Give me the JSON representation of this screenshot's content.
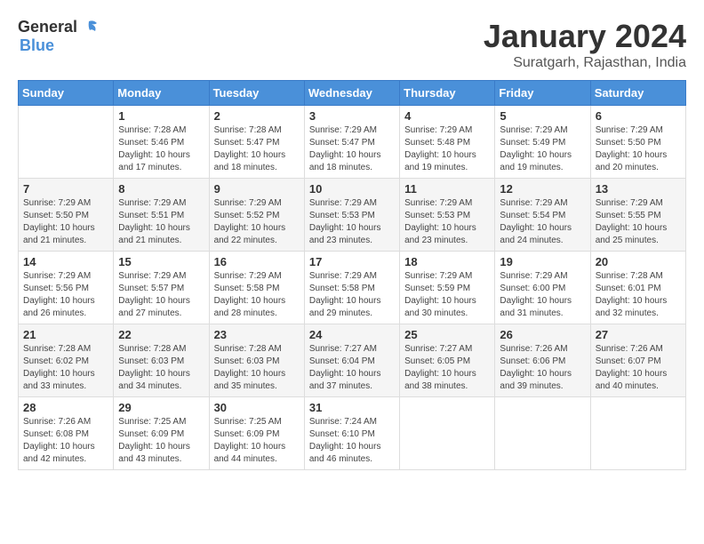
{
  "header": {
    "logo_general": "General",
    "logo_blue": "Blue",
    "month_title": "January 2024",
    "location": "Suratgarh, Rajasthan, India"
  },
  "weekdays": [
    "Sunday",
    "Monday",
    "Tuesday",
    "Wednesday",
    "Thursday",
    "Friday",
    "Saturday"
  ],
  "weeks": [
    [
      {
        "day": "",
        "sunrise": "",
        "sunset": "",
        "daylight": ""
      },
      {
        "day": "1",
        "sunrise": "Sunrise: 7:28 AM",
        "sunset": "Sunset: 5:46 PM",
        "daylight": "Daylight: 10 hours and 17 minutes."
      },
      {
        "day": "2",
        "sunrise": "Sunrise: 7:28 AM",
        "sunset": "Sunset: 5:47 PM",
        "daylight": "Daylight: 10 hours and 18 minutes."
      },
      {
        "day": "3",
        "sunrise": "Sunrise: 7:29 AM",
        "sunset": "Sunset: 5:47 PM",
        "daylight": "Daylight: 10 hours and 18 minutes."
      },
      {
        "day": "4",
        "sunrise": "Sunrise: 7:29 AM",
        "sunset": "Sunset: 5:48 PM",
        "daylight": "Daylight: 10 hours and 19 minutes."
      },
      {
        "day": "5",
        "sunrise": "Sunrise: 7:29 AM",
        "sunset": "Sunset: 5:49 PM",
        "daylight": "Daylight: 10 hours and 19 minutes."
      },
      {
        "day": "6",
        "sunrise": "Sunrise: 7:29 AM",
        "sunset": "Sunset: 5:50 PM",
        "daylight": "Daylight: 10 hours and 20 minutes."
      }
    ],
    [
      {
        "day": "7",
        "sunrise": "Sunrise: 7:29 AM",
        "sunset": "Sunset: 5:50 PM",
        "daylight": "Daylight: 10 hours and 21 minutes."
      },
      {
        "day": "8",
        "sunrise": "Sunrise: 7:29 AM",
        "sunset": "Sunset: 5:51 PM",
        "daylight": "Daylight: 10 hours and 21 minutes."
      },
      {
        "day": "9",
        "sunrise": "Sunrise: 7:29 AM",
        "sunset": "Sunset: 5:52 PM",
        "daylight": "Daylight: 10 hours and 22 minutes."
      },
      {
        "day": "10",
        "sunrise": "Sunrise: 7:29 AM",
        "sunset": "Sunset: 5:53 PM",
        "daylight": "Daylight: 10 hours and 23 minutes."
      },
      {
        "day": "11",
        "sunrise": "Sunrise: 7:29 AM",
        "sunset": "Sunset: 5:53 PM",
        "daylight": "Daylight: 10 hours and 23 minutes."
      },
      {
        "day": "12",
        "sunrise": "Sunrise: 7:29 AM",
        "sunset": "Sunset: 5:54 PM",
        "daylight": "Daylight: 10 hours and 24 minutes."
      },
      {
        "day": "13",
        "sunrise": "Sunrise: 7:29 AM",
        "sunset": "Sunset: 5:55 PM",
        "daylight": "Daylight: 10 hours and 25 minutes."
      }
    ],
    [
      {
        "day": "14",
        "sunrise": "Sunrise: 7:29 AM",
        "sunset": "Sunset: 5:56 PM",
        "daylight": "Daylight: 10 hours and 26 minutes."
      },
      {
        "day": "15",
        "sunrise": "Sunrise: 7:29 AM",
        "sunset": "Sunset: 5:57 PM",
        "daylight": "Daylight: 10 hours and 27 minutes."
      },
      {
        "day": "16",
        "sunrise": "Sunrise: 7:29 AM",
        "sunset": "Sunset: 5:58 PM",
        "daylight": "Daylight: 10 hours and 28 minutes."
      },
      {
        "day": "17",
        "sunrise": "Sunrise: 7:29 AM",
        "sunset": "Sunset: 5:58 PM",
        "daylight": "Daylight: 10 hours and 29 minutes."
      },
      {
        "day": "18",
        "sunrise": "Sunrise: 7:29 AM",
        "sunset": "Sunset: 5:59 PM",
        "daylight": "Daylight: 10 hours and 30 minutes."
      },
      {
        "day": "19",
        "sunrise": "Sunrise: 7:29 AM",
        "sunset": "Sunset: 6:00 PM",
        "daylight": "Daylight: 10 hours and 31 minutes."
      },
      {
        "day": "20",
        "sunrise": "Sunrise: 7:28 AM",
        "sunset": "Sunset: 6:01 PM",
        "daylight": "Daylight: 10 hours and 32 minutes."
      }
    ],
    [
      {
        "day": "21",
        "sunrise": "Sunrise: 7:28 AM",
        "sunset": "Sunset: 6:02 PM",
        "daylight": "Daylight: 10 hours and 33 minutes."
      },
      {
        "day": "22",
        "sunrise": "Sunrise: 7:28 AM",
        "sunset": "Sunset: 6:03 PM",
        "daylight": "Daylight: 10 hours and 34 minutes."
      },
      {
        "day": "23",
        "sunrise": "Sunrise: 7:28 AM",
        "sunset": "Sunset: 6:03 PM",
        "daylight": "Daylight: 10 hours and 35 minutes."
      },
      {
        "day": "24",
        "sunrise": "Sunrise: 7:27 AM",
        "sunset": "Sunset: 6:04 PM",
        "daylight": "Daylight: 10 hours and 37 minutes."
      },
      {
        "day": "25",
        "sunrise": "Sunrise: 7:27 AM",
        "sunset": "Sunset: 6:05 PM",
        "daylight": "Daylight: 10 hours and 38 minutes."
      },
      {
        "day": "26",
        "sunrise": "Sunrise: 7:26 AM",
        "sunset": "Sunset: 6:06 PM",
        "daylight": "Daylight: 10 hours and 39 minutes."
      },
      {
        "day": "27",
        "sunrise": "Sunrise: 7:26 AM",
        "sunset": "Sunset: 6:07 PM",
        "daylight": "Daylight: 10 hours and 40 minutes."
      }
    ],
    [
      {
        "day": "28",
        "sunrise": "Sunrise: 7:26 AM",
        "sunset": "Sunset: 6:08 PM",
        "daylight": "Daylight: 10 hours and 42 minutes."
      },
      {
        "day": "29",
        "sunrise": "Sunrise: 7:25 AM",
        "sunset": "Sunset: 6:09 PM",
        "daylight": "Daylight: 10 hours and 43 minutes."
      },
      {
        "day": "30",
        "sunrise": "Sunrise: 7:25 AM",
        "sunset": "Sunset: 6:09 PM",
        "daylight": "Daylight: 10 hours and 44 minutes."
      },
      {
        "day": "31",
        "sunrise": "Sunrise: 7:24 AM",
        "sunset": "Sunset: 6:10 PM",
        "daylight": "Daylight: 10 hours and 46 minutes."
      },
      {
        "day": "",
        "sunrise": "",
        "sunset": "",
        "daylight": ""
      },
      {
        "day": "",
        "sunrise": "",
        "sunset": "",
        "daylight": ""
      },
      {
        "day": "",
        "sunrise": "",
        "sunset": "",
        "daylight": ""
      }
    ]
  ]
}
